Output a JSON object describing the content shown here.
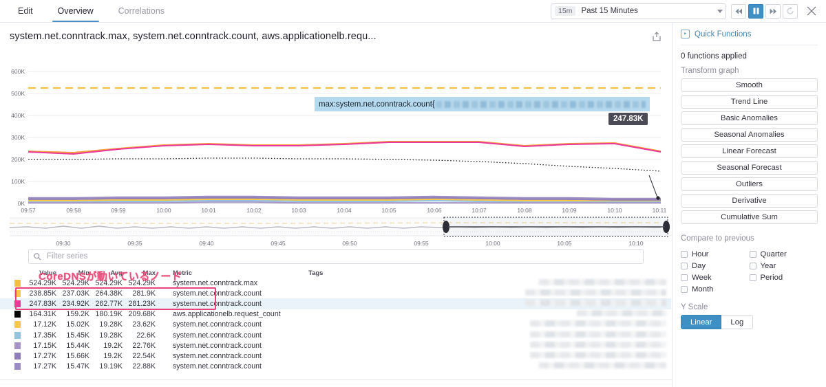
{
  "tabs": [
    {
      "label": "Edit",
      "active": false,
      "muted": false
    },
    {
      "label": "Overview",
      "active": true,
      "muted": false
    },
    {
      "label": "Correlations",
      "active": false,
      "muted": true
    }
  ],
  "timepicker": {
    "badge": "15m",
    "label": "Past 15 Minutes"
  },
  "nav": {
    "back_icon": "skip-backward-icon",
    "pause_icon": "pause-icon",
    "forward_icon": "skip-forward-icon",
    "reset_icon": "reset-icon",
    "close_icon": "close-icon"
  },
  "header": {
    "title": "system.net.conntrack.max, system.net.conntrack.count, aws.applicationelb.requ...",
    "share_icon": "export-icon"
  },
  "tooltip": {
    "series_label": "max:system.net.conntrack.count{",
    "value_badge": "247.83K"
  },
  "filter": {
    "placeholder": "Filter series",
    "value": "",
    "icon": "search-icon"
  },
  "annotation": {
    "text": "CoreDNSが動いているノード",
    "color": "#e8527f",
    "box_color": "#e8437a"
  },
  "legend": {
    "headers": [
      "Value",
      "Min",
      "Avg",
      "Max",
      "Metric",
      "Tags"
    ],
    "rows": [
      {
        "color": "#f0c040",
        "value": "524.29K",
        "min": "524.29K",
        "avg": "524.29K",
        "max": "524.29K",
        "metric": "system.net.conntrack.max",
        "highlight": false
      },
      {
        "color": "#f5c84b",
        "value": "238.85K",
        "min": "237.03K",
        "avg": "264.38K",
        "max": "281.9K",
        "metric": "system.net.conntrack.count",
        "highlight": false
      },
      {
        "color": "#e8399a",
        "value": "247.83K",
        "min": "234.92K",
        "avg": "262.77K",
        "max": "281.23K",
        "metric": "system.net.conntrack.count",
        "highlight": true
      },
      {
        "color": "#000000",
        "value": "164.31K",
        "min": "159.2K",
        "avg": "180.19K",
        "max": "209.68K",
        "metric": "aws.applicationelb.request_count",
        "highlight": false
      },
      {
        "color": "#f5c84b",
        "value": "17.12K",
        "min": "15.02K",
        "avg": "19.28K",
        "max": "23.62K",
        "metric": "system.net.conntrack.count",
        "highlight": false
      },
      {
        "color": "#90c3e0",
        "value": "17.35K",
        "min": "15.45K",
        "avg": "19.28K",
        "max": "22.6K",
        "metric": "system.net.conntrack.count",
        "highlight": false
      },
      {
        "color": "#a694c9",
        "value": "17.15K",
        "min": "15.44K",
        "avg": "19.2K",
        "max": "22.76K",
        "metric": "system.net.conntrack.count",
        "highlight": false
      },
      {
        "color": "#8f7db8",
        "value": "17.27K",
        "min": "15.66K",
        "avg": "19.2K",
        "max": "22.54K",
        "metric": "system.net.conntrack.count",
        "highlight": false
      },
      {
        "color": "#9b8cc4",
        "value": "17.27K",
        "min": "15.47K",
        "avg": "19.19K",
        "max": "22.88K",
        "metric": "system.net.conntrack.count",
        "highlight": false
      }
    ]
  },
  "panel": {
    "quick_functions_title": "Quick Functions",
    "quick_functions_icon": "function-icon",
    "functions_applied": "0 functions applied",
    "transform_label": "Transform graph",
    "transform_buttons": [
      "Smooth",
      "Trend Line",
      "Basic Anomalies",
      "Seasonal Anomalies",
      "Linear Forecast",
      "Seasonal Forecast",
      "Outliers",
      "Derivative",
      "Cumulative Sum"
    ],
    "compare_label": "Compare to previous",
    "compare_options": [
      "Hour",
      "Quarter",
      "Day",
      "Year",
      "Week",
      "Period",
      "Month"
    ],
    "yscale_label": "Y Scale",
    "yscale_options": [
      {
        "label": "Linear",
        "selected": true
      },
      {
        "label": "Log",
        "selected": false
      }
    ]
  },
  "chart_data": {
    "type": "line",
    "title": "system.net.conntrack.max, system.net.conntrack.count, aws.applicationelb.requ...",
    "xlabel": "",
    "ylabel": "",
    "ylim": [
      0,
      650000
    ],
    "yticks": [
      "0K",
      "100K",
      "200K",
      "300K",
      "400K",
      "500K",
      "600K"
    ],
    "ytick_values": [
      0,
      100000,
      200000,
      300000,
      400000,
      500000,
      600000
    ],
    "xticks": [
      "09:57",
      "09:58",
      "09:59",
      "10:00",
      "10:01",
      "10:02",
      "10:03",
      "10:04",
      "10:05",
      "10:06",
      "10:07",
      "10:08",
      "10:09",
      "10:10",
      "10:11"
    ],
    "grid": true,
    "legend_position": "below-table",
    "series": [
      {
        "name": "system.net.conntrack.max",
        "color": "#f0c040",
        "style": "dashed",
        "values": [
          524290,
          524290,
          524290,
          524290,
          524290,
          524290,
          524290,
          524290,
          524290,
          524290,
          524290,
          524290,
          524290,
          524290,
          524290
        ]
      },
      {
        "name": "system.net.conntrack.count (orange)",
        "color": "#f5a03c",
        "style": "solid",
        "values": [
          238000,
          232000,
          248000,
          262000,
          268000,
          262000,
          262000,
          266000,
          274000,
          281900,
          274000,
          262000,
          268000,
          266000,
          238850
        ]
      },
      {
        "name": "system.net.conntrack.count (pink)",
        "color": "#e8399a",
        "style": "solid",
        "values": [
          236000,
          234920,
          247000,
          261000,
          266000,
          260000,
          260000,
          264000,
          272000,
          281230,
          272000,
          260000,
          266000,
          264000,
          247830
        ]
      },
      {
        "name": "aws.applicationelb.request_count",
        "color": "#000000",
        "style": "dotted",
        "values": [
          200000,
          201000,
          202000,
          203000,
          204000,
          203500,
          203000,
          202500,
          201000,
          198000,
          193000,
          186000,
          178000,
          171000,
          164310
        ]
      },
      {
        "name": "system.net.conntrack.count (node a)",
        "color": "#f5c84b",
        "style": "solid",
        "values": [
          19000,
          19500,
          20000,
          21000,
          22000,
          21500,
          20500,
          19800,
          20200,
          23620,
          21000,
          19000,
          18000,
          17500,
          17120
        ]
      },
      {
        "name": "system.net.conntrack.count (node b)",
        "color": "#90c3e0",
        "style": "solid",
        "values": [
          19200,
          19600,
          20100,
          21200,
          22000,
          21600,
          20600,
          19900,
          20300,
          22600,
          21100,
          19200,
          18100,
          17600,
          17350
        ]
      },
      {
        "name": "system.net.conntrack.count (node c)",
        "color": "#a694c9",
        "style": "solid",
        "values": [
          19100,
          19500,
          20000,
          21100,
          21900,
          21500,
          20500,
          19800,
          20200,
          22760,
          21000,
          19100,
          18000,
          17500,
          17150
        ]
      },
      {
        "name": "system.net.conntrack.count (node d)",
        "color": "#8f7db8",
        "style": "solid",
        "values": [
          19150,
          19550,
          20050,
          21150,
          21950,
          21550,
          20550,
          19850,
          20250,
          22540,
          21050,
          19150,
          18050,
          17550,
          17270
        ]
      },
      {
        "name": "system.net.conntrack.count (node e)",
        "color": "#9b8cc4",
        "style": "solid",
        "values": [
          19120,
          19520,
          20020,
          21120,
          21920,
          21520,
          20520,
          19820,
          20220,
          22880,
          21020,
          19120,
          18020,
          17520,
          17270
        ]
      }
    ],
    "minimap": {
      "xticks": [
        "09:30",
        "09:35",
        "09:40",
        "09:45",
        "09:50",
        "09:55",
        "10:00",
        "10:05",
        "10:10"
      ],
      "selection_start": "09:56",
      "selection_end": "10:11"
    }
  }
}
